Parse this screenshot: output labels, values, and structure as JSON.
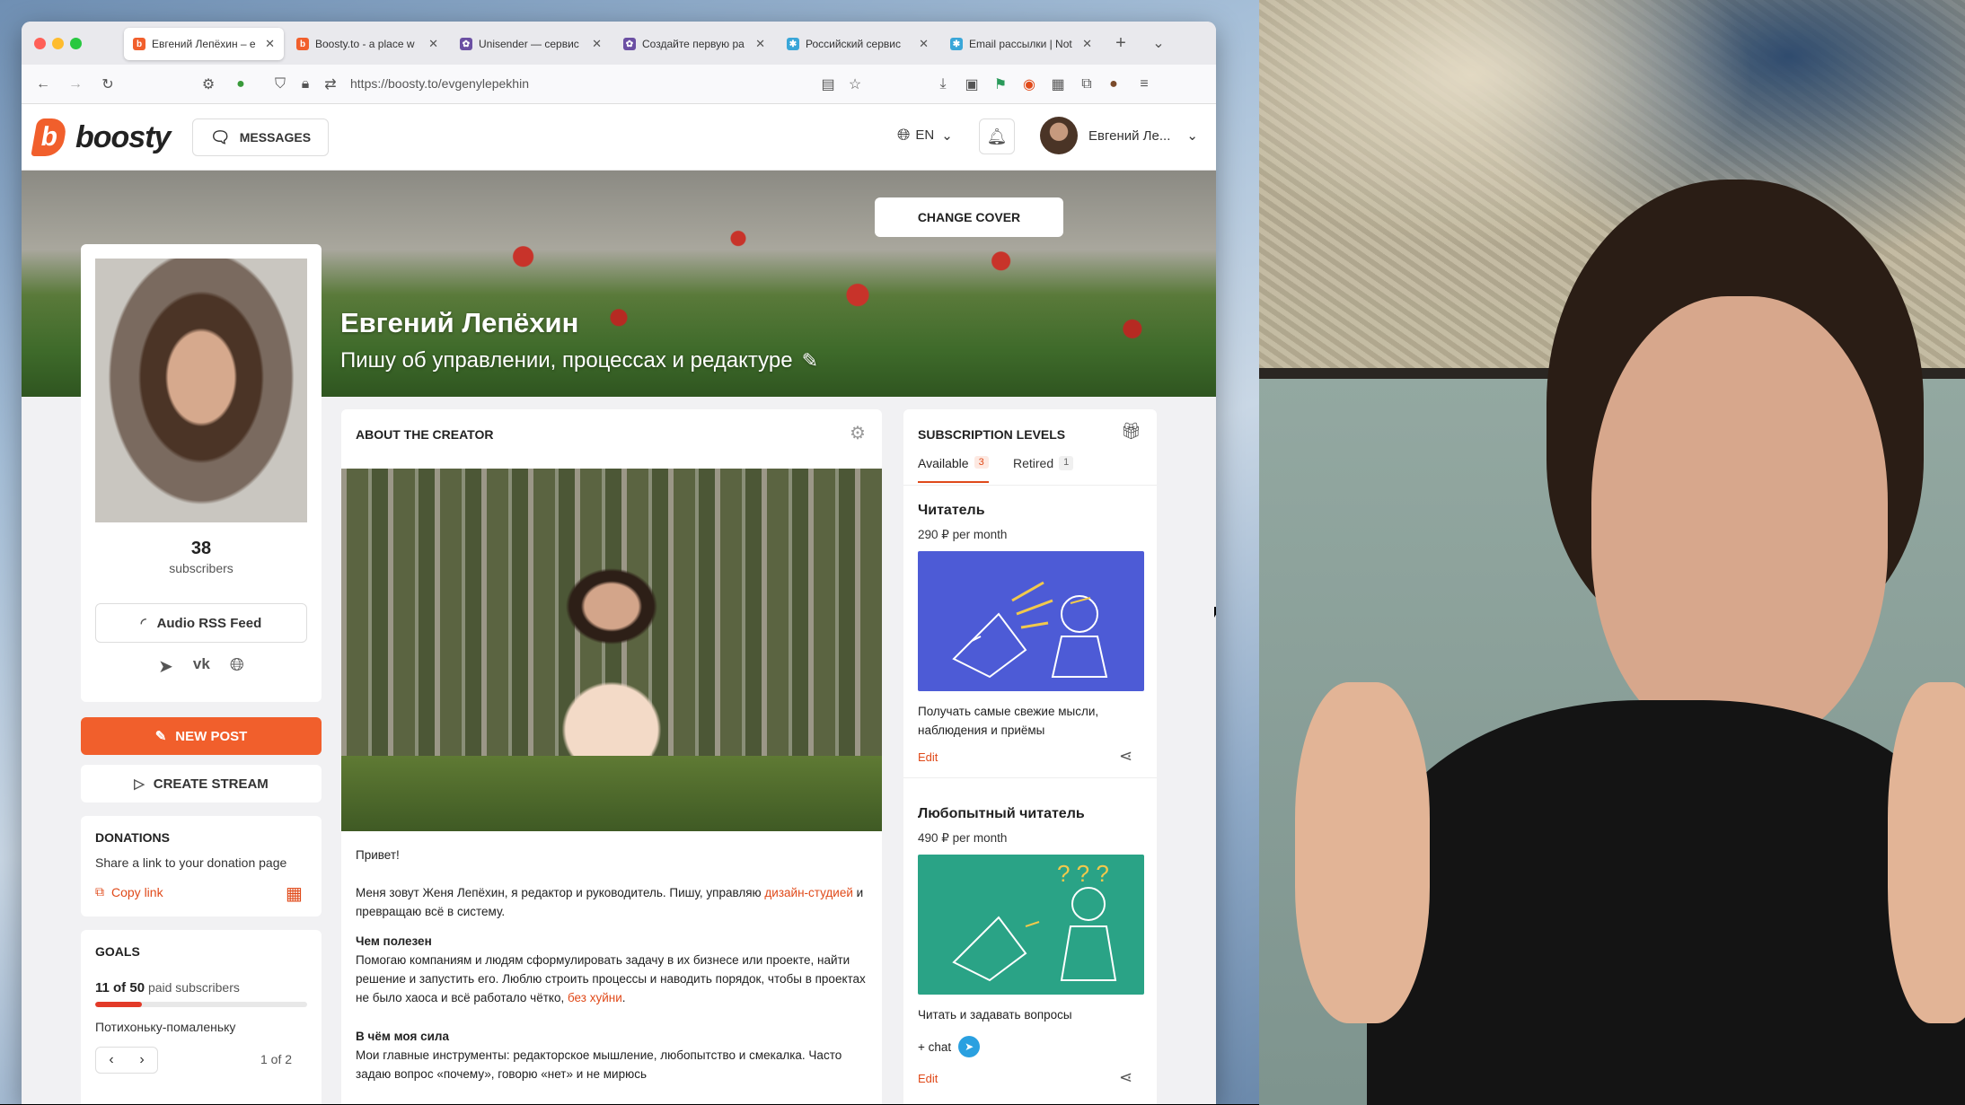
{
  "browser": {
    "tabs": [
      {
        "title": "Евгений Лепёхин – е",
        "favicon": "boosty-icon",
        "active": true
      },
      {
        "title": "Boosty.to - a place w",
        "favicon": "boosty-icon",
        "active": false
      },
      {
        "title": "Unisender — сервис",
        "favicon": "unisender-icon",
        "active": false
      },
      {
        "title": "Создайте первую ра",
        "favicon": "unisender-icon",
        "active": false
      },
      {
        "title": "Российский сервис",
        "favicon": "notisend-icon",
        "active": false
      },
      {
        "title": "Email рассылки | Not",
        "favicon": "notisend-icon",
        "active": false
      }
    ],
    "url": "https://boosty.to/evgenylepekhin"
  },
  "header": {
    "logo_text": "boosty",
    "messages_label": "MESSAGES",
    "lang_label": "EN",
    "user_name": "Евгений Ле..."
  },
  "cover": {
    "change_cover_label": "CHANGE COVER",
    "name": "Евгений Лепёхин",
    "description": "Пишу об управлении, процессах и редактуре"
  },
  "profile": {
    "subscribers_count": "38",
    "subscribers_label": "subscribers",
    "rss_label": "Audio RSS Feed",
    "new_post_label": "NEW POST",
    "create_stream_label": "CREATE STREAM"
  },
  "donations": {
    "title": "DONATIONS",
    "description": "Share a link to your donation page",
    "copy_label": "Copy link"
  },
  "goals": {
    "title": "GOALS",
    "progress_value": "11 of 50",
    "progress_unit": "paid subscribers",
    "progress_fraction": 0.22,
    "name": "Потихоньку-помаленьку",
    "page": "1 of 2"
  },
  "about": {
    "title": "ABOUT THE CREATOR",
    "greeting": "Привет!",
    "intro_1": "Меня зовут Женя Лепёхин, я редактор и руководитель. Пишу, управляю ",
    "intro_link": "дизайн-студией",
    "intro_2": " и превращаю всё в систему.",
    "useful_title": "Чем полезен",
    "useful_1": "Помогаю компаниям и людям сформулировать задачу в их бизнесе или проекте, найти решение и запустить его. Люблю строить процессы и наводить порядок, чтобы в проектах не было хаоса и всё работало чётко, ",
    "useful_link": "без хуйни",
    "useful_2": ".",
    "power_title": "В чём моя сила",
    "power_text": "Мои главные инструменты: редакторское мышление, любопытство и смекалка. Часто задаю вопрос «почему», говорю «нет» и не мирюсь"
  },
  "subscriptions": {
    "title": "SUBSCRIPTION LEVELS",
    "tab_available": "Available",
    "tab_available_count": "3",
    "tab_retired": "Retired",
    "tab_retired_count": "1",
    "levels": [
      {
        "name": "Читатель",
        "price": "290 ₽ per month",
        "description": "Получать самые свежие мысли, наблюдения и приёмы",
        "edit_label": "Edit",
        "color": "#4d5bd6"
      },
      {
        "name": "Любопытный читатель",
        "price": "490 ₽ per month",
        "description": "Читать и задавать вопросы",
        "extra": "+ chat",
        "edit_label": "Edit",
        "color": "#2aa386"
      }
    ]
  },
  "colors": {
    "accent": "#f15f2c",
    "link": "#e04a1a",
    "progress": "#e33a28"
  }
}
